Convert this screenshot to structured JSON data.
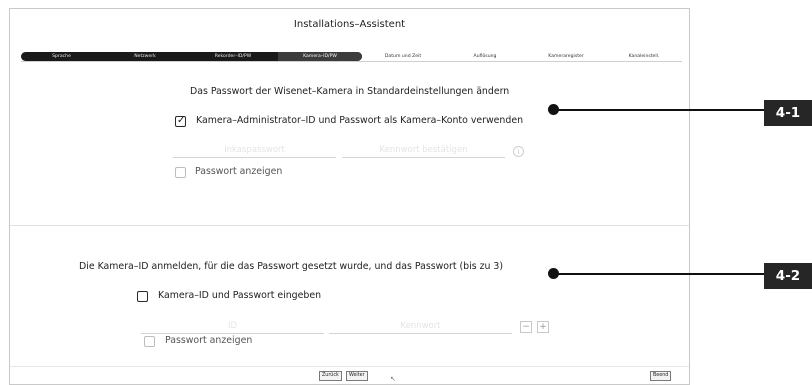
{
  "wizard": {
    "title": "Installations–Assistent",
    "steps": [
      {
        "label": "Sprache",
        "state": "done"
      },
      {
        "label": "Netzwerk",
        "state": "done"
      },
      {
        "label": "Rekorder–ID/PW",
        "state": "done"
      },
      {
        "label": "Kamera–ID/PW",
        "state": "active"
      },
      {
        "label": "Datum und Zeit",
        "state": "pending"
      },
      {
        "label": "Auflösung",
        "state": "pending"
      },
      {
        "label": "Kameraregister",
        "state": "pending"
      },
      {
        "label": "Kanaleinstell.",
        "state": "pending"
      }
    ]
  },
  "section1": {
    "heading": "Das Passwort der Wisenet–Kamera in Standardeinstellungen ändern",
    "use_admin_checkbox_label": "Kamera–Administrator–ID und Passwort als Kamera–Konto verwenden",
    "use_admin_checked": true,
    "new_password_placeholder": "Inkaspasswort",
    "confirm_password_placeholder": "Kennwort bestätigen",
    "info_icon": "info-icon",
    "show_password_label": "Passwort anzeigen",
    "show_password_checked": false
  },
  "section2": {
    "heading": "Die Kamera–ID anmelden, für die das Passwort gesetzt wurde, und das Passwort (bis zu 3)",
    "enter_checkbox_label": "Kamera–ID und Passwort eingeben",
    "enter_checked": false,
    "id_placeholder": "ID",
    "password_placeholder": "Kennwort",
    "minus_label": "−",
    "plus_label": "+",
    "show_password_label": "Passwort anzeigen",
    "show_password_checked": false
  },
  "footer": {
    "back_label": "Zurück",
    "next_label": "Weiter",
    "end_label": "Beend"
  },
  "callouts": [
    {
      "label": "4-1"
    },
    {
      "label": "4-2"
    }
  ],
  "colors": {
    "step_done": "#1a1a1a",
    "step_active": "#3c3c3c",
    "callout": "#262626"
  }
}
